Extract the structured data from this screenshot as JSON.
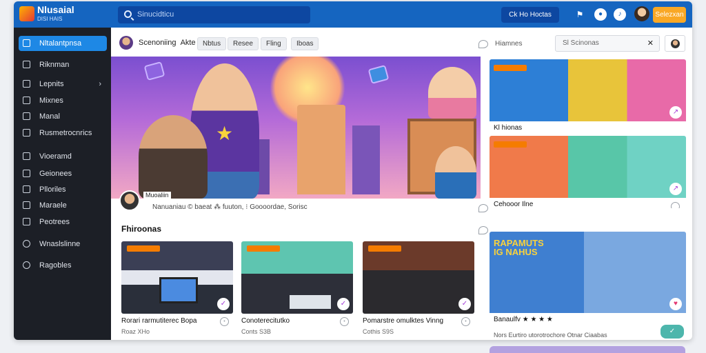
{
  "app": {
    "brand": "Nlusaial",
    "brand_sub": "DISI HAIS"
  },
  "topbar": {
    "search_placeholder": "Sinucidticu",
    "button_label": "Ck  Ho Hoctas",
    "cta_label": "Selezxan",
    "icons": [
      "search-icon",
      "flag-icon",
      "notification-icon",
      "settings-icon"
    ]
  },
  "sidebar": {
    "items": [
      {
        "label": "Nltalantpnsa",
        "active": true,
        "icon": "edit-icon"
      },
      {
        "label": "Riknman",
        "icon": "home-icon"
      },
      {
        "label": "Lepnits",
        "icon": "list-icon",
        "chevron": true
      },
      {
        "label": "Mixnes",
        "icon": "grid-icon"
      },
      {
        "label": "Manal",
        "icon": "box-icon"
      },
      {
        "label": "Rusmetrocnrics",
        "icon": "chart-icon"
      },
      {
        "label": "Vioeramd",
        "icon": "video-icon"
      },
      {
        "label": "Geionees",
        "icon": "layers-icon"
      },
      {
        "label": "Plloriles",
        "icon": "tag-icon"
      },
      {
        "label": "Maraele",
        "icon": "music-icon"
      },
      {
        "label": "Peotrees",
        "icon": "people-icon"
      },
      {
        "label": "Wnaslslinne",
        "icon": "circle-icon"
      },
      {
        "label": "Ragobles",
        "icon": "settings-icon"
      }
    ]
  },
  "main": {
    "channel": "Scenoniing",
    "channel_sub": "Akte",
    "chips": [
      "Nbtus",
      "Resee",
      "Fling",
      "Iboas"
    ],
    "hero_avatar_label": "Muoaliin",
    "hero_title": "Nanuaniau  ©  baeat  ⁂  fuuton,  ⁝  Goooordae,  Sorisc",
    "section_title": "Fhiroonas",
    "cards": [
      {
        "title": "Rorari rarmutiterec Bopa",
        "sub": "Roaz  XHo"
      },
      {
        "title": "Conoterecitutko",
        "sub": "Conts  S3B"
      },
      {
        "title": "Pomarstre omulktes Vinng",
        "sub": "Cothis  S9S"
      }
    ]
  },
  "right": {
    "label": "Hiamnes",
    "search": "Sl Scinonas",
    "cards": [
      {
        "title": "Kl hionas",
        "sub": ""
      },
      {
        "title": "Cehooor Ilne",
        "sub": ""
      },
      {
        "title": "Banaulfv  ★ ★ ★ ★",
        "sub": "Nors  Eurtiro utorotrochore Otnar  Ciaabas",
        "banner": "RAPAMUTS IG NAHUS"
      }
    ],
    "fab": "✓"
  },
  "colors": {
    "topbar": "#1565c0",
    "sidebar": "#1c1f26",
    "accent": "#1e88e5",
    "cta": "#f9a825"
  }
}
